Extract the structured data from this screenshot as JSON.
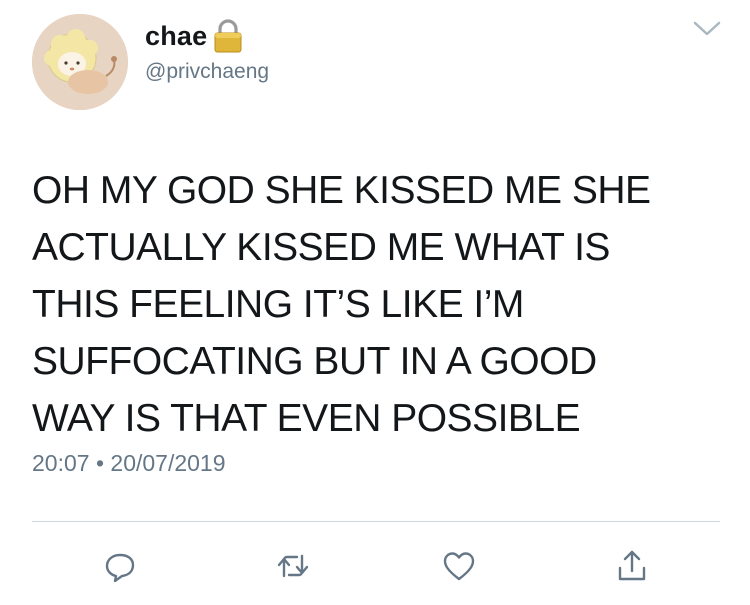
{
  "header": {
    "display_name": "chae",
    "handle": "@privchaeng",
    "icons": {
      "avatar": "lion-cub-avatar",
      "lock": "lock-icon",
      "menu": "chevron-down-icon"
    }
  },
  "tweet": {
    "text": "OH MY GOD SHE KISSED ME SHE\nACTUALLY KISSED ME WHAT IS\nTHIS FEELING IT’S LIKE I’M\nSUFFOCATING BUT IN A GOOD\nWAY IS THAT EVEN POSSIBLE",
    "time": "20:07",
    "separator": "•",
    "date": "20/07/2019"
  },
  "actions": {
    "icons": [
      "reply-icon",
      "retweet-icon",
      "like-icon",
      "share-icon"
    ]
  },
  "colors": {
    "text": "#14171a",
    "secondary": "#657786",
    "divider": "#cfd5da",
    "avatar_bg": "#e8d4c2"
  }
}
